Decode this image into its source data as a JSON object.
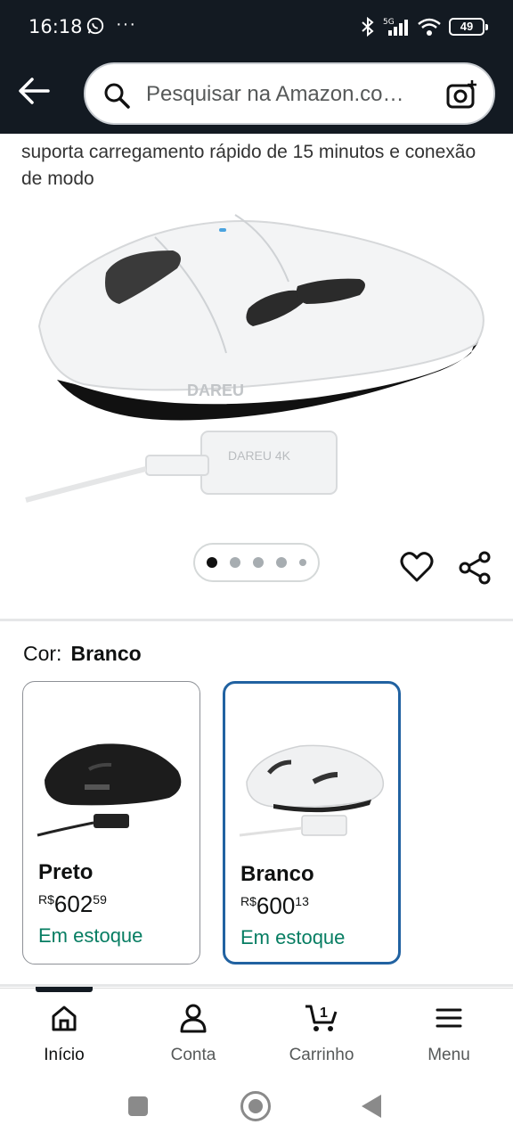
{
  "status_bar": {
    "time": "16:18",
    "dots": "···",
    "network": "5G",
    "battery": "49"
  },
  "search": {
    "placeholder": "Pesquisar na Amazon.co…"
  },
  "description": "suporta carregamento rápido de 15 minutos e conexão de modo",
  "product": {
    "brand_on_mouse": "DAREU",
    "brand_on_receiver": "DAREU 4K"
  },
  "carousel": {
    "total": 5,
    "active": 0
  },
  "color": {
    "label": "Cor:",
    "selected": "Branco"
  },
  "variants": [
    {
      "name": "Preto",
      "currency": "R$",
      "price_int": "602",
      "price_cents": "59",
      "stock": "Em estoque",
      "swatch": "#1a1a1a"
    },
    {
      "name": "Branco",
      "currency": "R$",
      "price_int": "600",
      "price_cents": "13",
      "stock": "Em estoque",
      "swatch": "#f2f2f2"
    }
  ],
  "nav": {
    "home": "Início",
    "account": "Conta",
    "cart": "Carrinho",
    "cart_count": "1",
    "menu": "Menu"
  },
  "colors": {
    "header_bg": "#131a22",
    "stock_green": "#067d62",
    "selected_border": "#2162a1"
  }
}
